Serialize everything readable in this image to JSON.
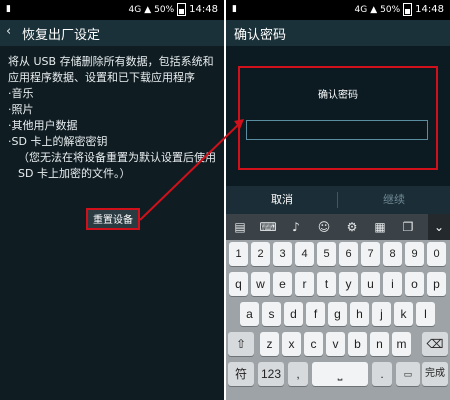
{
  "status": {
    "network": "4G",
    "battery": "50%",
    "time": "14:48"
  },
  "left": {
    "back_icon": "back-arrow",
    "title": "恢复出厂设定",
    "intro": "将从 USB 存储删除所有数据，包括系统和应用程序数据、设置和已下载应用程序",
    "items": [
      "·音乐",
      "·照片",
      "·其他用户数据",
      "·SD 卡上的解密密钥"
    ],
    "note": "（您无法在将设备重置为默认设置后使用 SD 卡上加密的文件。）",
    "reset_button": "重置设备"
  },
  "right": {
    "title": "确认密码",
    "dialog_title": "确认密码",
    "password_value": "",
    "cancel": "取消",
    "continue": "继续"
  },
  "keyboard": {
    "tools": [
      "clipboard-icon",
      "keyboard-icon",
      "mic-icon",
      "emoji-icon",
      "settings-icon",
      "keyboard-layout-icon",
      "copy-icon",
      "chevron-down-icon"
    ],
    "row_numbers": [
      "1",
      "2",
      "3",
      "4",
      "5",
      "6",
      "7",
      "8",
      "9",
      "0"
    ],
    "row1": [
      "q",
      "w",
      "e",
      "r",
      "t",
      "y",
      "u",
      "i",
      "o",
      "p"
    ],
    "row2": [
      "a",
      "s",
      "d",
      "f",
      "g",
      "h",
      "j",
      "k",
      "l"
    ],
    "row3": [
      "z",
      "x",
      "c",
      "v",
      "b",
      "n",
      "m"
    ],
    "row4": {
      "sym": "符",
      "num": "123",
      "dot": ".",
      "enter": "完成"
    }
  },
  "colors": {
    "highlight": "#d0101a"
  }
}
